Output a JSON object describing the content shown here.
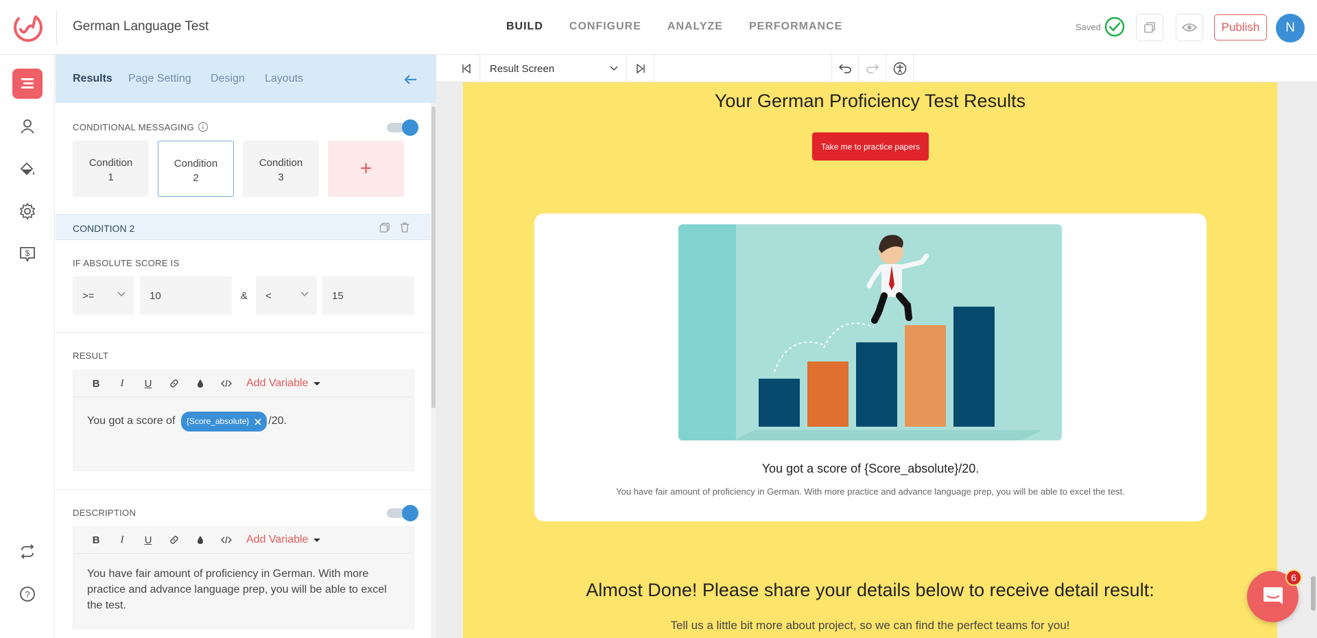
{
  "header": {
    "app_title": "German Language Test",
    "nav": [
      {
        "label": "BUILD",
        "active": true
      },
      {
        "label": "CONFIGURE",
        "active": false
      },
      {
        "label": "ANALYZE",
        "active": false
      },
      {
        "label": "PERFORMANCE",
        "active": false
      }
    ],
    "saved_label": "Saved",
    "publish_label": "Publish",
    "avatar_initial": "N"
  },
  "rail": {
    "items": [
      "content-icon",
      "user-icon",
      "paint-bucket-icon",
      "gear-icon",
      "pricing-icon",
      "sync-icon",
      "help-icon"
    ]
  },
  "panel": {
    "tabs": [
      "Results",
      "Page Setting",
      "Design",
      "Layouts"
    ],
    "active_tab": "Results",
    "conditional_messaging_label": "CONDITIONAL MESSAGING",
    "conditional_messaging_enabled": true,
    "conditions": [
      {
        "line1": "Condition",
        "line2": "1"
      },
      {
        "line1": "Condition",
        "line2": "2"
      },
      {
        "line1": "Condition",
        "line2": "3"
      }
    ],
    "add_condition_symbol": "+",
    "condition_header": "CONDITION 2",
    "score_rule_label": "IF ABSOLUTE SCORE IS",
    "operator1": ">=",
    "value1": "10",
    "joiner": "&",
    "operator2": "<",
    "value2": "15",
    "result_label": "RESULT",
    "add_variable_label": "Add Variable",
    "result_text_before": "You got a score of ",
    "result_variable": "{Score_absolute}",
    "result_text_after": "/20.",
    "description_label": "DESCRIPTION",
    "description_enabled": true,
    "description_text": "You have fair amount of proficiency in German. With more practice and advance language prep, you will be able to excel the test.",
    "toolbar_tools": [
      "B",
      "I",
      "U",
      "link-icon",
      "color-drop-icon",
      "code-icon"
    ]
  },
  "canvas": {
    "screen_selected": "Result Screen",
    "result_title": "Your German Proficiency Test Results",
    "practice_button": "Take me to practice papers",
    "score_text": "You got a score of {Score_absolute}/20.",
    "description_text": "You have fair amount of proficiency in German. With more practice and advance language prep, you will be able to excel the test.",
    "almost_done_title": "Almost Done! Please share your details below to receive detail result:",
    "tell_us_text": "Tell us a little bit more about project, so we can find the perfect teams for you!"
  },
  "chat": {
    "badge_count": "6"
  },
  "colors": {
    "accent_red": "#ef5f67",
    "accent_blue": "#3a8fd6",
    "page_yellow": "#fde46a",
    "button_red": "#e0242b"
  }
}
